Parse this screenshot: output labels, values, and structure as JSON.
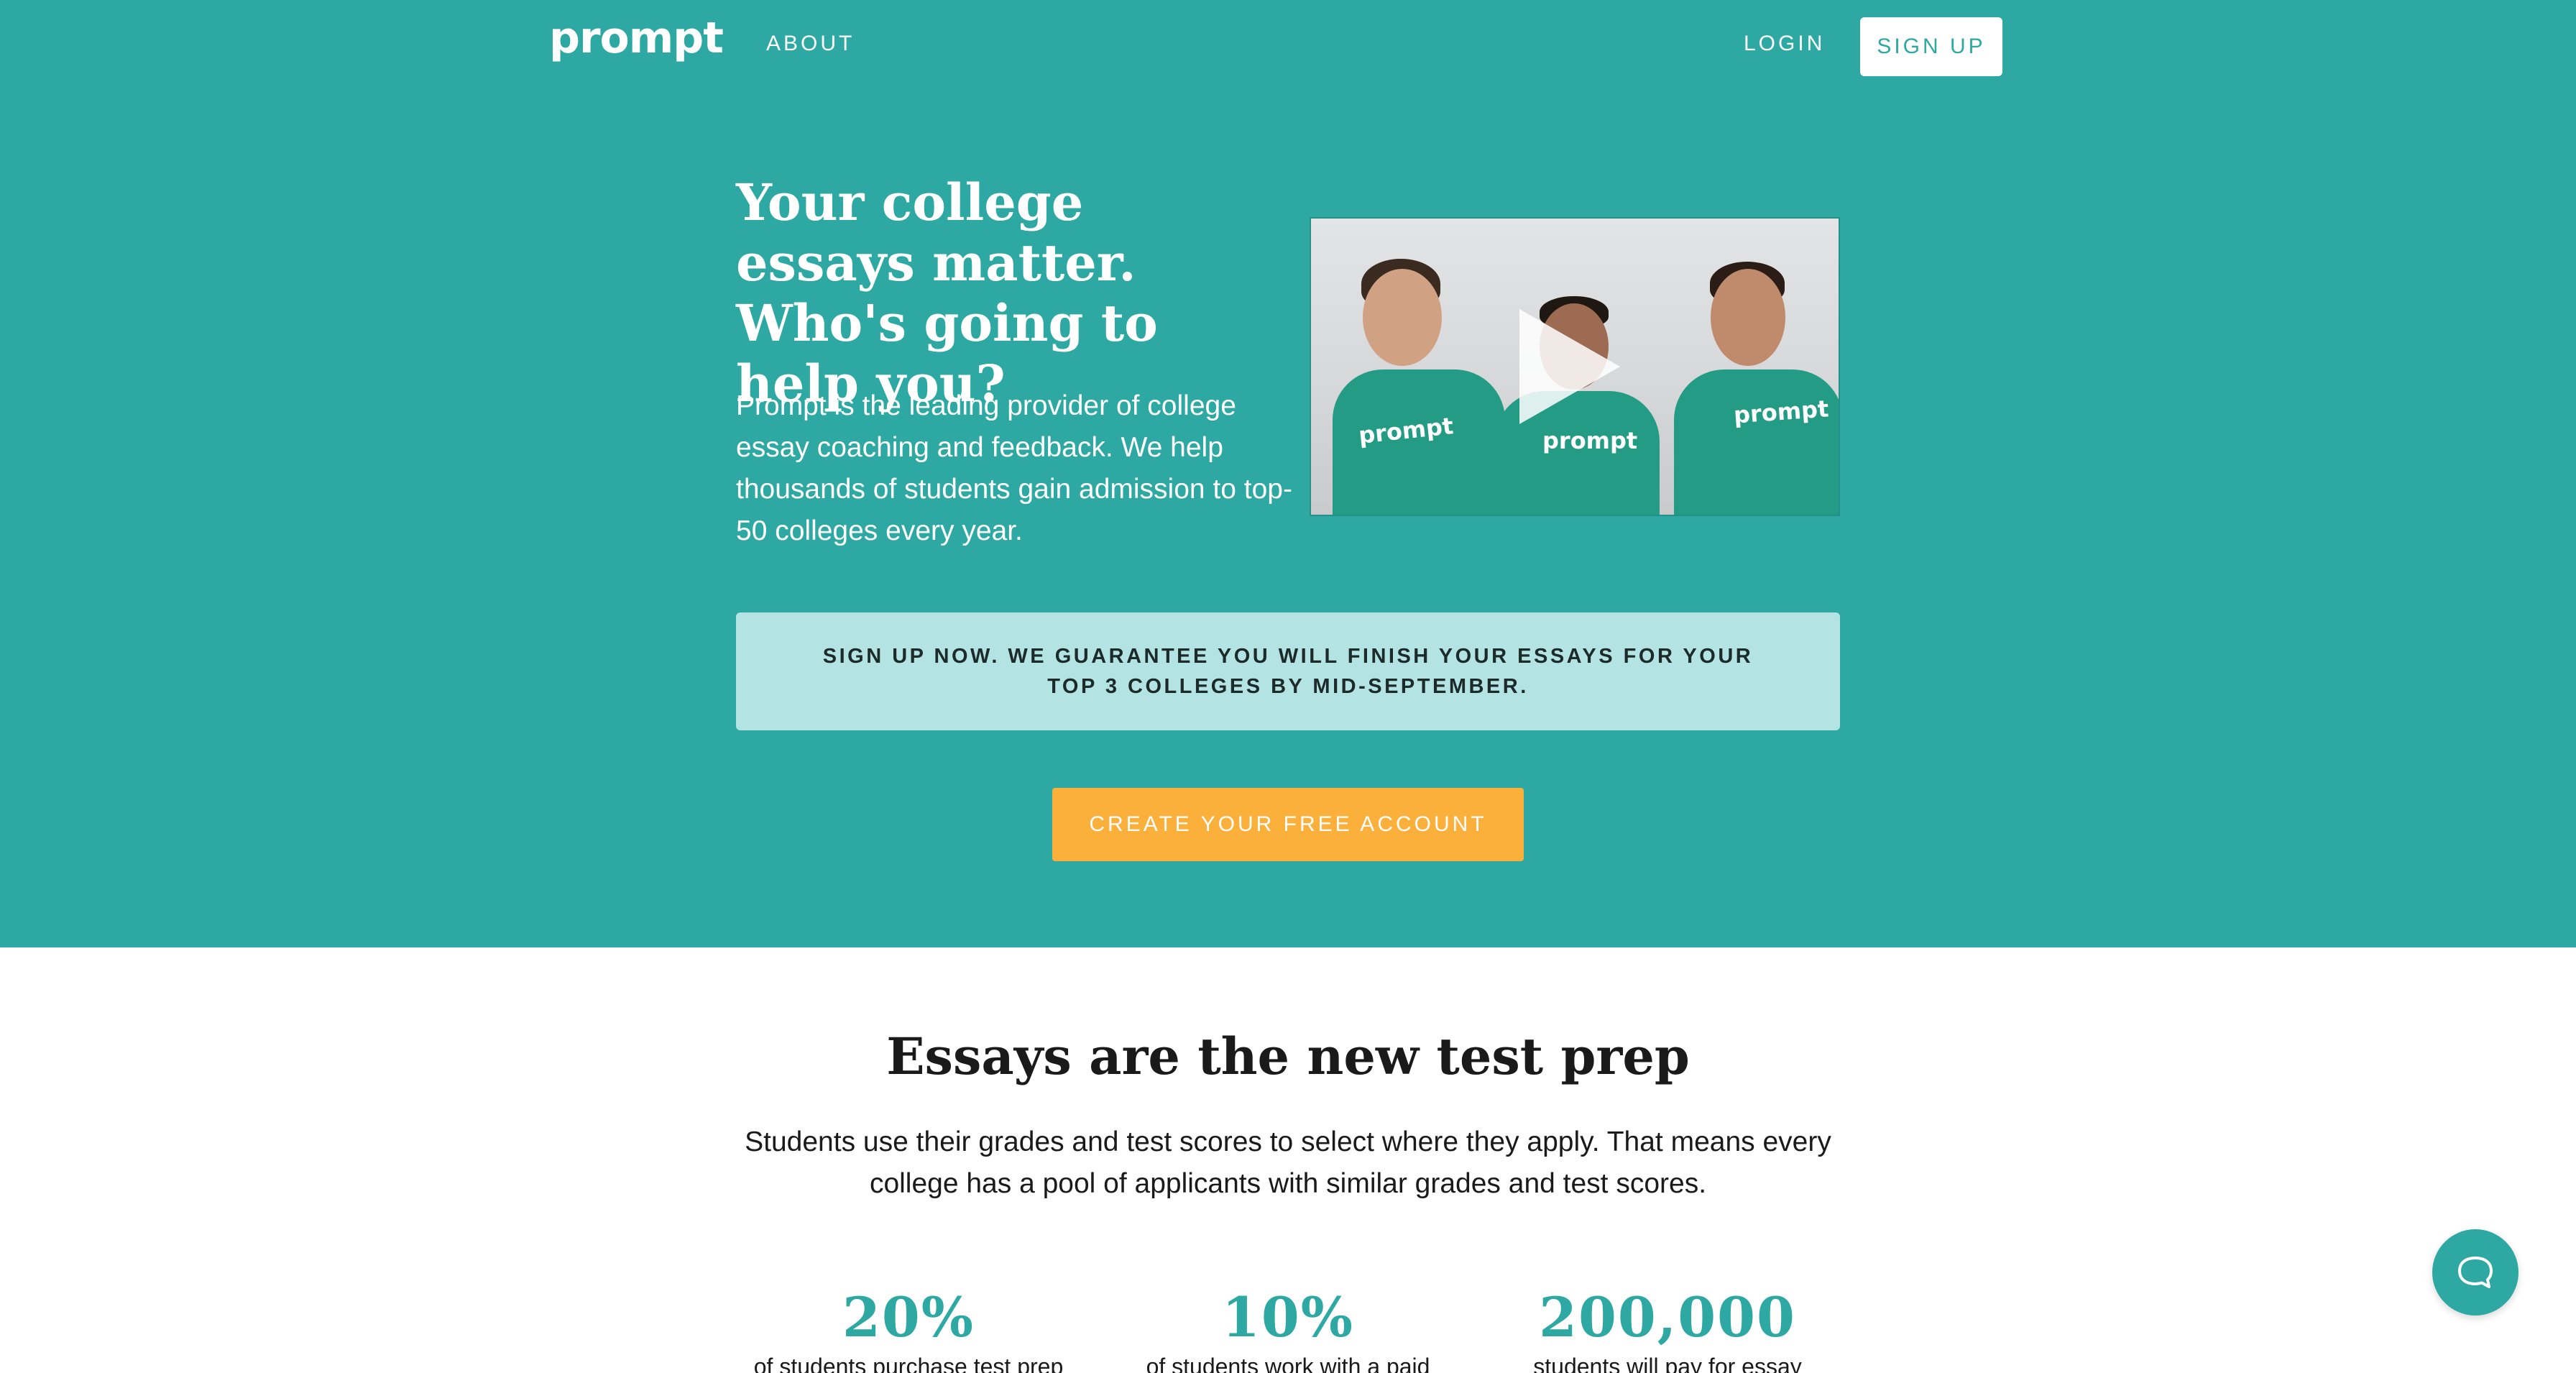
{
  "nav": {
    "logo": "prompt",
    "about": "ABOUT",
    "login": "LOGIN",
    "signup": "SIGN UP"
  },
  "hero": {
    "title": "Your college essays matter. Who's going to help you?",
    "description": "Prompt is the leading provider of college essay coaching and feedback. We help thousands of students gain admission to top-50 colleges every year.",
    "video_shirt_text": [
      "prompt",
      "prompt",
      "prompt"
    ],
    "guarantee": "SIGN UP NOW. WE GUARANTEE YOU WILL FINISH YOUR ESSAYS FOR YOUR TOP 3 COLLEGES BY MID-SEPTEMBER.",
    "cta": "CREATE YOUR FREE ACCOUNT"
  },
  "section": {
    "title": "Essays are the new test prep",
    "description": "Students use their grades and test scores to select where they apply. That means every college has a pool of applicants with similar grades and test scores."
  },
  "stats": [
    {
      "value": "20%",
      "label": "of students purchase test prep"
    },
    {
      "value": "10%",
      "label": "of students work with a paid"
    },
    {
      "value": "200,000",
      "label": "students will pay for essay"
    }
  ],
  "colors": {
    "brand_teal": "#2ea8a2",
    "guarantee_bg": "#b3e4e3",
    "cta_orange": "#fbb03b"
  },
  "icons": {
    "video": "play-icon",
    "chat": "chat-bubble-icon"
  }
}
